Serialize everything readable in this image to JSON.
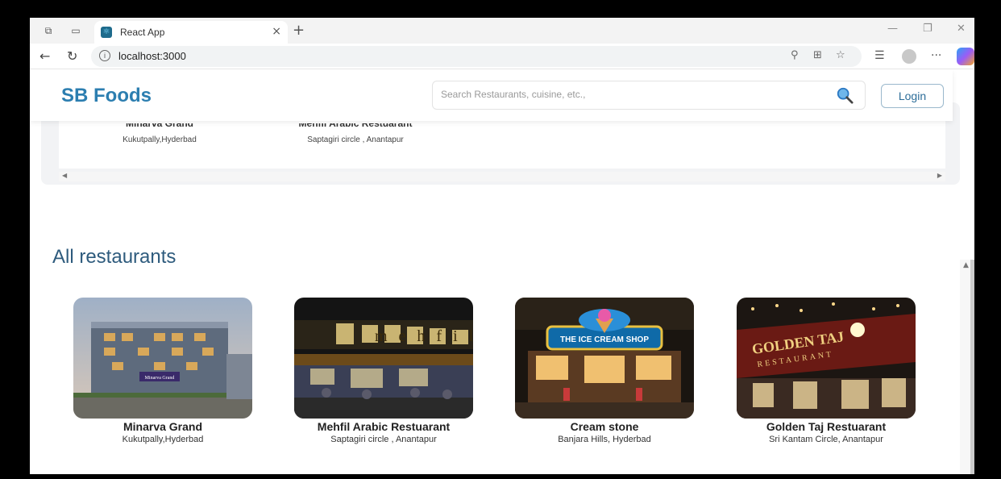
{
  "browser": {
    "tab_title": "React App",
    "tab_close": "×",
    "new_tab": "+",
    "url": "localhost:3000",
    "icons": [
      "workspaces-icon",
      "tab-actions-icon",
      "react-favicon",
      "back-icon",
      "refresh-icon",
      "info-icon",
      "read-aloud-icon",
      "immersive-reader-icon",
      "favorite-icon",
      "collections-icon",
      "profile-icon",
      "more-icon",
      "copilot-icon"
    ]
  },
  "header": {
    "brand": "SB Foods",
    "search_placeholder": "Search Restaurants, cuisine, etc.,",
    "login_label": "Login"
  },
  "popular": [
    {
      "name": "Minarva Grand",
      "location": "Kukutpally,Hyderbad"
    },
    {
      "name": "Mehfil Arabic Restuarant",
      "location": "Saptagiri circle , Anantapur"
    }
  ],
  "section_title": "All restaurants",
  "restaurants": [
    {
      "name": "Minarva Grand",
      "location": "Kukutpally,Hyderbad",
      "sign": "Minarva Grand"
    },
    {
      "name": "Mehfil Arabic Restuarant",
      "location": "Saptagiri circle , Anantapur",
      "sign": "mehfil"
    },
    {
      "name": "Cream stone",
      "location": "Banjara Hills, Hyderbad",
      "sign": "THE ICE CREAM SHOP"
    },
    {
      "name": "Golden Taj Restuarant",
      "location": "Sri Kantam Circle, Anantapur",
      "sign": "GOLDEN TAJ",
      "sign2": "RESTAURANT"
    }
  ],
  "colors": {
    "brand": "#2c7eb0",
    "section_title": "#2e5b7d",
    "login_border": "#9ab8cc"
  }
}
